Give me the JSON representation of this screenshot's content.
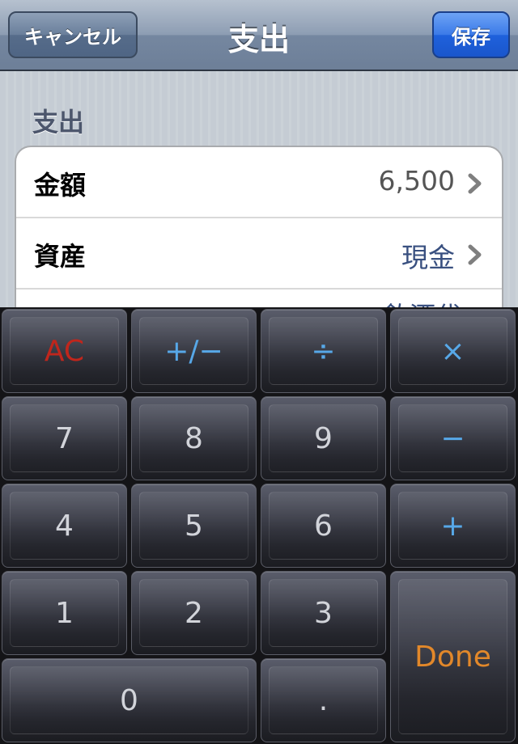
{
  "nav": {
    "title": "支出",
    "cancel_label": "キャンセル",
    "save_label": "保存"
  },
  "section": {
    "header": "支出",
    "rows": [
      {
        "label": "金額",
        "value": "6,500"
      },
      {
        "label": "資産",
        "value": "現金"
      },
      {
        "label": "",
        "value": "飲酒代"
      }
    ]
  },
  "keypad": {
    "ac": "AC",
    "plus_minus": "+/−",
    "divide": "÷",
    "multiply": "×",
    "seven": "7",
    "eight": "8",
    "nine": "9",
    "minus": "−",
    "four": "4",
    "five": "5",
    "six": "6",
    "plus": "+",
    "one": "1",
    "two": "2",
    "three": "3",
    "done": "Done",
    "zero": "0",
    "decimal": "."
  }
}
